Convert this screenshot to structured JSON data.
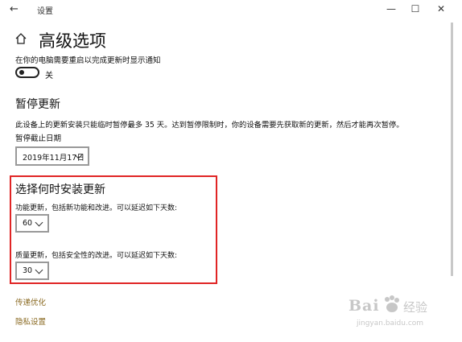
{
  "window": {
    "title": "设置",
    "back_glyph": "←",
    "minimize_glyph": "—",
    "maximize_glyph": "☐",
    "close_glyph": "✕"
  },
  "page": {
    "title": "高级选项",
    "home_icon": "home-icon"
  },
  "restart_notify": {
    "label": "在你的电脑需要重启以完成更新时显示通知",
    "state": "关",
    "on": false
  },
  "pause": {
    "heading": "暂停更新",
    "description": "此设备上的更新安装只能临时暂停最多 35 天。达到暂停限制时，你的设备需要先获取新的更新，然后才能再次暂停。",
    "date_label": "暂停截止日期",
    "date_value": "2019年11月17日"
  },
  "install_when": {
    "heading": "选择何时安装更新",
    "feature_label": "功能更新，包括新功能和改进。可以延迟如下天数:",
    "feature_value": "60",
    "quality_label": "质量更新，包括安全性的改进。可以延迟如下天数:",
    "quality_value": "30"
  },
  "links": {
    "delivery": "传递优化",
    "privacy": "隐私设置"
  },
  "watermark": {
    "brand_a": "Bai",
    "brand_b": "经验",
    "url": "jingyan.baidu.com"
  },
  "colors": {
    "highlight": "#e02525",
    "link": "#8a6a22"
  }
}
